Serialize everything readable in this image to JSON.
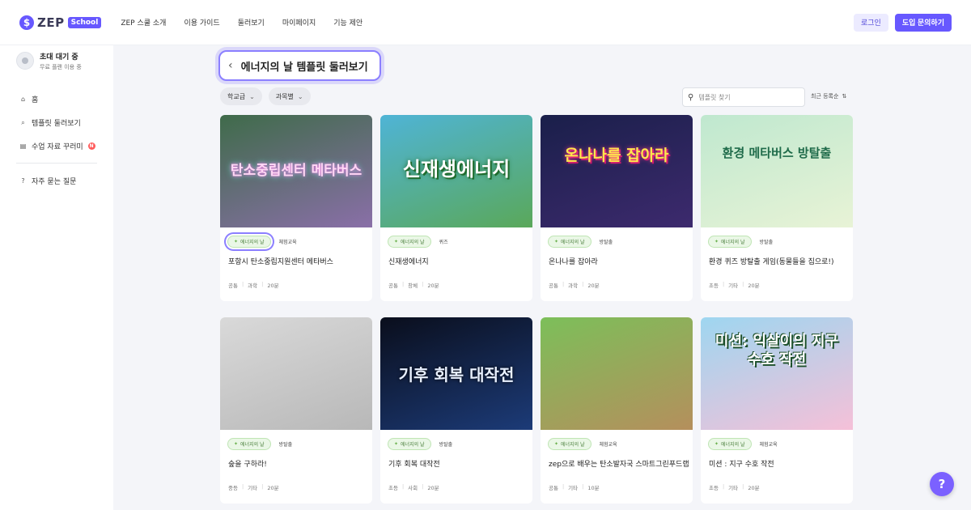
{
  "nav": {
    "logo_mark": "$",
    "logo_text": "ZEP",
    "logo_badge": "School",
    "items": [
      "ZEP 스쿨 소개",
      "이용 가이드",
      "둘러보기",
      "마이페이지",
      "기능 제안"
    ],
    "login": "로그인",
    "inquiry": "도입 문의하기"
  },
  "profile": {
    "name": "초대 대기 중",
    "sub": "무료 플랜 이용 중"
  },
  "sidebar": {
    "items": [
      {
        "label": "홈",
        "icon": "home-icon"
      },
      {
        "label": "템플릿 둘러보기",
        "icon": "search-icon"
      },
      {
        "label": "수업 자료 꾸러미",
        "icon": "document-icon",
        "badge": "N"
      }
    ],
    "faq": "자주 묻는 질문"
  },
  "page": {
    "title": "에너지의 날 템플릿 둘러보기",
    "filters": [
      "학교급",
      "과목별"
    ],
    "search_placeholder": "템플릿 찾기",
    "sort": "최근 등록순"
  },
  "cards": [
    {
      "thumb_title": "탄소중립센터 메타버스",
      "tag": "에너지의 날",
      "type": "체험교육",
      "title": "포항시 탄소중립지원센터 메타버스",
      "level": "공통",
      "subject": "과학",
      "time": "20분",
      "colors": [
        "#3f6b4a",
        "#8a6fa8"
      ]
    },
    {
      "thumb_title": "신재생에너지",
      "tag": "에너지의 날",
      "type": "퀴즈",
      "title": "신재생에너지",
      "level": "공통",
      "subject": "창체",
      "time": "20분",
      "colors": [
        "#4fb4d6",
        "#5aa85a"
      ]
    },
    {
      "thumb_title": "온나나를 잡아라",
      "tag": "에너지의 날",
      "type": "방탈출",
      "title": "온나나를 잡아라",
      "level": "공통",
      "subject": "과학",
      "time": "20분",
      "colors": [
        "#1a1f4a",
        "#3d2a6e"
      ]
    },
    {
      "thumb_title": "환경 메타버스 방탈출",
      "tag": "에너지의 날",
      "type": "방탈출",
      "title": "환경 퀴즈 방탈출 게임(동물들을 집으로!)",
      "level": "초등",
      "subject": "기타",
      "time": "20분",
      "colors": [
        "#bfe8cf",
        "#e8f3d6"
      ]
    },
    {
      "thumb_title": "",
      "tag": "에너지의 날",
      "type": "방탈출",
      "title": "숲을 구하라!",
      "level": "중등",
      "subject": "기타",
      "time": "20분",
      "colors": [
        "#d9d9d9",
        "#b8b8b8"
      ]
    },
    {
      "thumb_title": "기후 회복 대작전",
      "tag": "에너지의 날",
      "type": "방탈출",
      "title": "기후 회복 대작전",
      "level": "초등",
      "subject": "사회",
      "time": "20분",
      "colors": [
        "#0a0e1c",
        "#1c3b78"
      ]
    },
    {
      "thumb_title": "",
      "tag": "에너지의 날",
      "type": "체험교육",
      "title": "zep으로 배우는 탄소발자국 스마트그린푸드랩",
      "level": "공통",
      "subject": "기타",
      "time": "10분",
      "colors": [
        "#7cbf5a",
        "#b58f5c"
      ]
    },
    {
      "thumb_title": "미션: 익살이의 지구 수호 작전",
      "tag": "에너지의 날",
      "type": "체험교육",
      "title": "미션 : 지구 수호 작전",
      "level": "초등",
      "subject": "기타",
      "time": "20분",
      "colors": [
        "#9ed6f0",
        "#f5c0d8"
      ]
    }
  ],
  "help": "?"
}
